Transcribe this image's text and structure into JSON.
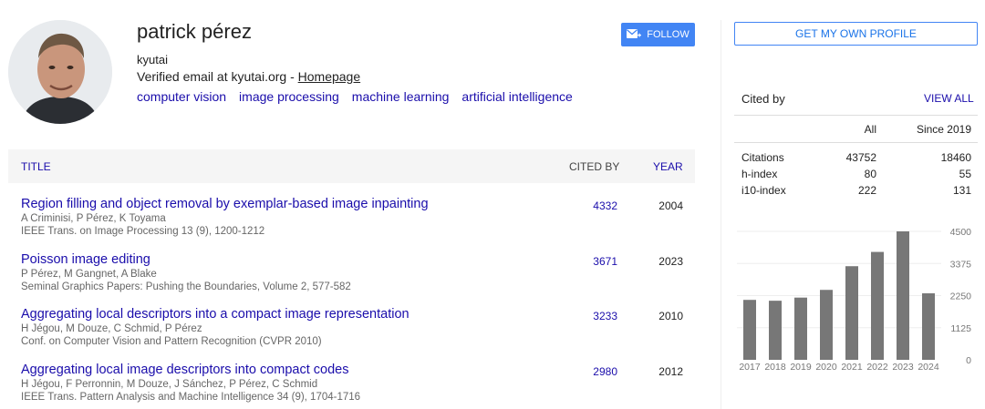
{
  "profile": {
    "name": "patrick pérez",
    "affiliation": "kyutai",
    "email_text": "Verified email at kyutai.org - ",
    "homepage_label": "Homepage",
    "interests": [
      "computer vision",
      "image processing",
      "machine learning",
      "artificial intelligence"
    ]
  },
  "buttons": {
    "follow": "FOLLOW",
    "get_profile": "GET MY OWN PROFILE"
  },
  "table": {
    "headers": {
      "title": "TITLE",
      "cited_by": "CITED BY",
      "year": "YEAR"
    },
    "articles": [
      {
        "title": "Region filling and object removal by exemplar-based image inpainting",
        "authors": "A Criminisi, P Pérez, K Toyama",
        "venue": "IEEE Trans. on Image Processing 13 (9), 1200-1212",
        "cited_by": "4332",
        "year": "2004"
      },
      {
        "title": "Poisson image editing",
        "authors": "P Pérez, M Gangnet, A Blake",
        "venue": "Seminal Graphics Papers: Pushing the Boundaries, Volume 2, 577-582",
        "cited_by": "3671",
        "year": "2023"
      },
      {
        "title": "Aggregating local descriptors into a compact image representation",
        "authors": "H Jégou, M Douze, C Schmid, P Pérez",
        "venue": "Conf. on Computer Vision and Pattern Recognition (CVPR 2010)",
        "cited_by": "3233",
        "year": "2010"
      },
      {
        "title": "Aggregating local image descriptors into compact codes",
        "authors": "H Jégou, F Perronnin, M Douze, J Sánchez, P Pérez, C Schmid",
        "venue": "IEEE Trans. Pattern Analysis and Machine Intelligence 34 (9), 1704-1716",
        "cited_by": "2980",
        "year": "2012"
      }
    ]
  },
  "cited_by": {
    "title": "Cited by",
    "view_all": "VIEW ALL",
    "col_all": "All",
    "col_since": "Since 2019",
    "stats": [
      {
        "label": "Citations",
        "all": "43752",
        "since": "18460"
      },
      {
        "label": "h-index",
        "all": "80",
        "since": "55"
      },
      {
        "label": "i10-index",
        "all": "222",
        "since": "131"
      }
    ]
  },
  "colors": {
    "link": "#1a0dab",
    "accent": "#4285f4",
    "bar": "#777777"
  },
  "chart_data": {
    "type": "bar",
    "categories": [
      "2017",
      "2018",
      "2019",
      "2020",
      "2021",
      "2022",
      "2023",
      "2024"
    ],
    "values": [
      2100,
      2070,
      2180,
      2450,
      3280,
      3780,
      4500,
      2330
    ],
    "yticks": [
      0,
      1125,
      2250,
      3375,
      4500
    ],
    "ylim": [
      0,
      4500
    ],
    "grid": true
  }
}
